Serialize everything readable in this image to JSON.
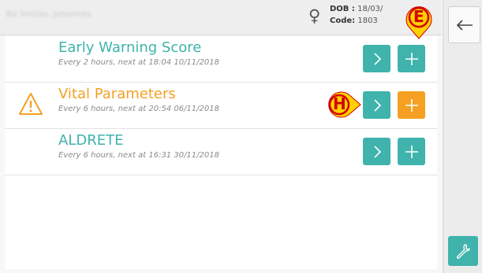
{
  "header": {
    "patient_name": "Ba Vrolias, Johannes",
    "gender_symbol": "♀",
    "dob_label": "DOB :",
    "dob_value": "18/03/",
    "code_label": "Code:",
    "code_value": "1803"
  },
  "rows": [
    {
      "title": "Early Warning Score",
      "subtitle": "Every 2 hours, next at 18:04 10/11/2018",
      "status": "normal"
    },
    {
      "title": "Vital Parameters",
      "subtitle": "Every 6 hours, next at 20:54 06/11/2018",
      "status": "warning"
    },
    {
      "title": "ALDRETE",
      "subtitle": "Every 6 hours, next at 16:31 30/11/2018",
      "status": "normal"
    }
  ],
  "markers": {
    "e_label": "E",
    "h_label": "H"
  },
  "colors": {
    "teal": "#3fb3ac",
    "orange": "#f5a023",
    "marker_yellow": "#ffd000",
    "marker_red": "#d20000"
  },
  "sidebar": {
    "back_icon": "arrow-left-icon",
    "tool_icon": "wrench-icon"
  }
}
